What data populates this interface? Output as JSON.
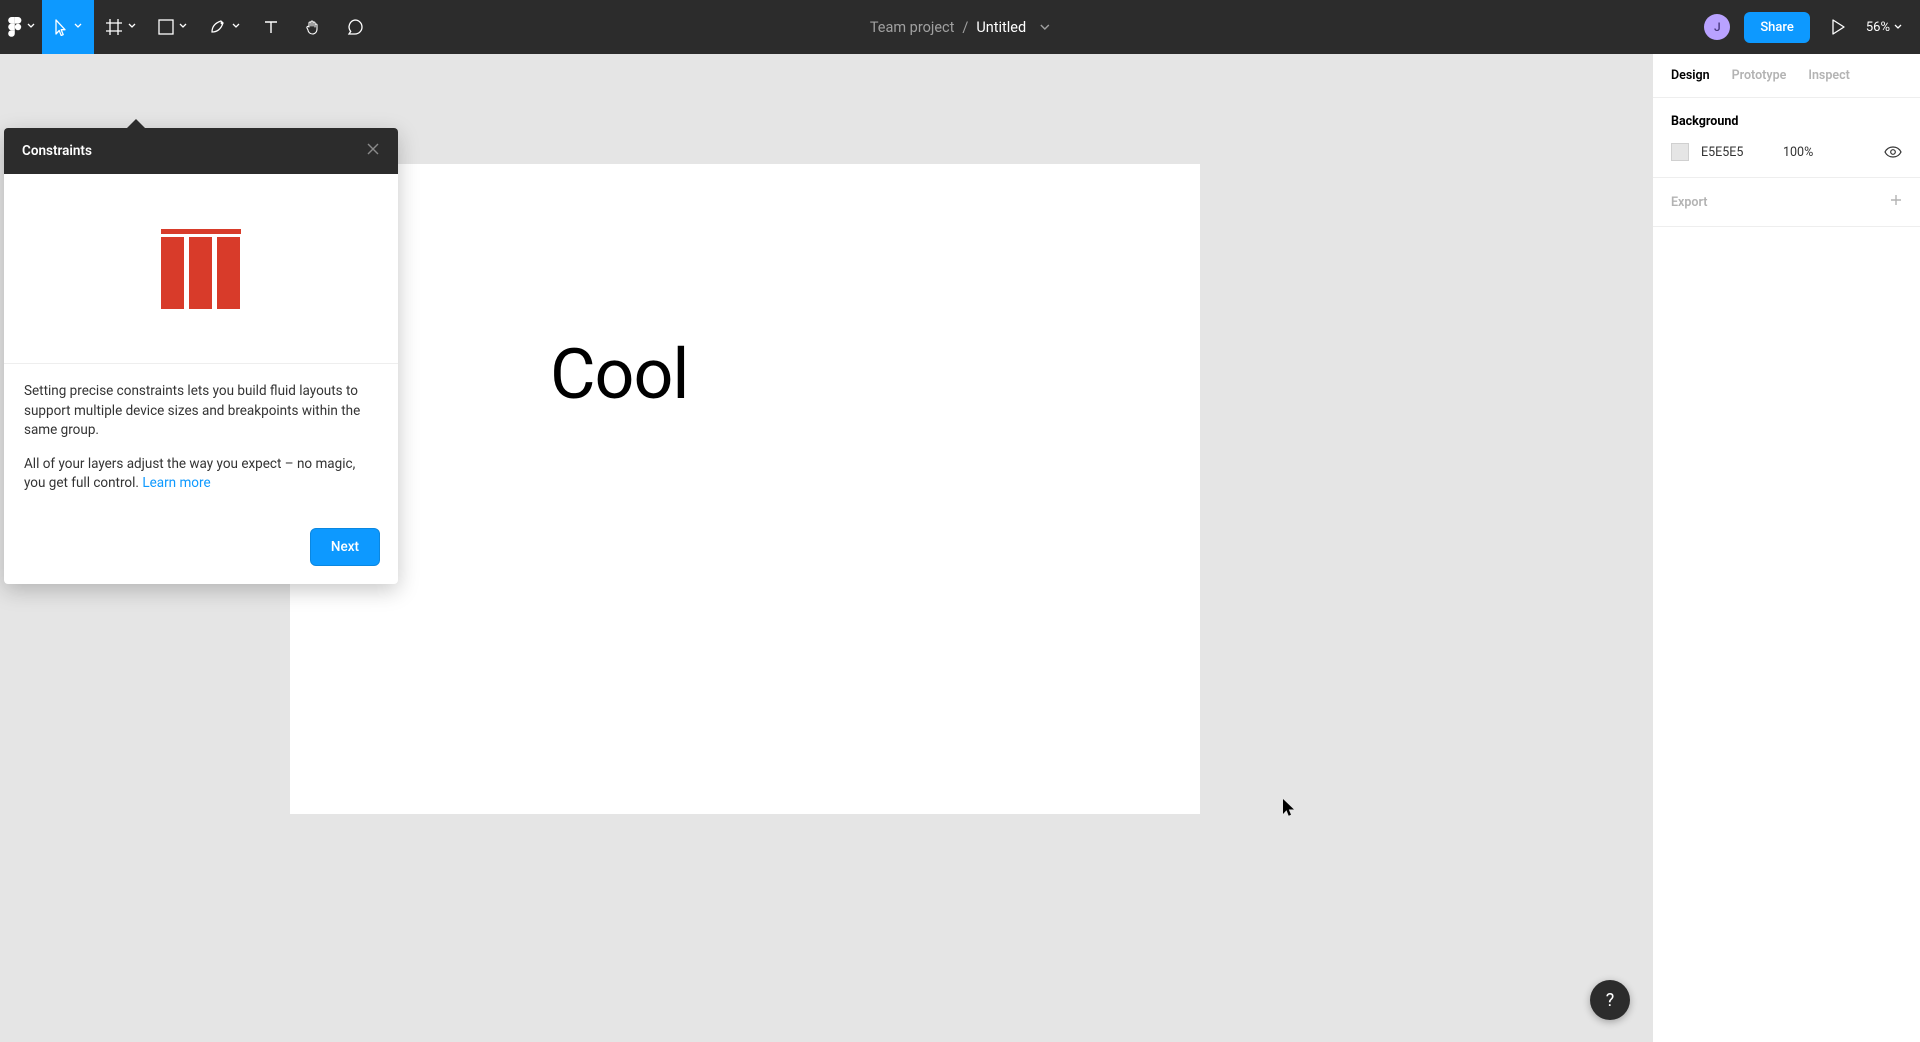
{
  "toolbar": {
    "breadcrumb_team": "Team project",
    "breadcrumb_sep": "/",
    "breadcrumb_file": "Untitled",
    "share_label": "Share",
    "zoom_label": "56%",
    "avatar_initial": "J"
  },
  "inspector": {
    "tabs": {
      "design": "Design",
      "prototype": "Prototype",
      "inspect": "Inspect"
    },
    "background_title": "Background",
    "bg_hex": "E5E5E5",
    "bg_opacity": "100%",
    "export_title": "Export"
  },
  "canvas": {
    "text": "Cool"
  },
  "popup": {
    "title": "Constraints",
    "para1": "Setting precise constraints lets you build fluid layouts to support multiple device sizes and breakpoints within the same group.",
    "para2_a": "All of your layers adjust the way you expect – no magic, you get full control. ",
    "learn_more": "Learn more",
    "next": "Next"
  },
  "help": {
    "glyph": "?"
  }
}
